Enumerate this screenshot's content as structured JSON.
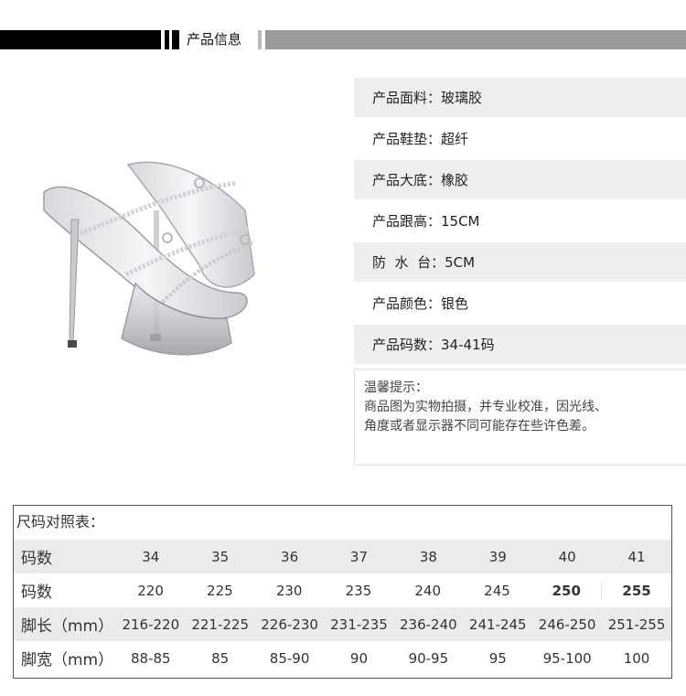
{
  "header": {
    "title": "产品信息"
  },
  "specs": [
    {
      "text": "产品面料：玻璃胶"
    },
    {
      "text": "产品鞋垫：超纤"
    },
    {
      "text": "产品大底：橡胶"
    },
    {
      "text": "产品跟高：15CM"
    },
    {
      "text": "防  水  台：5CM"
    },
    {
      "text": "产品颜色：银色"
    },
    {
      "text": "产品码数：34-41码"
    }
  ],
  "notice": {
    "title": "温馨提示：",
    "line1": "商品图为实物拍摄，并专业校准，因光线、",
    "line2": "角度或者显示器不同可能存在些许色差。"
  },
  "size_table": {
    "title": "尺码对照表：",
    "rows": [
      {
        "label": "码数",
        "cells": [
          "34",
          "35",
          "36",
          "37",
          "38",
          "39",
          "40",
          "41"
        ]
      },
      {
        "label": "码数",
        "cells": [
          "220",
          "225",
          "230",
          "235",
          "240",
          "245",
          "250",
          "255"
        ]
      },
      {
        "label": "脚长（mm）",
        "cells": [
          "216-220",
          "221-225",
          "226-230",
          "231-235",
          "236-240",
          "241-245",
          "246-250",
          "251-255"
        ]
      },
      {
        "label": "脚宽（mm）",
        "cells": [
          "88-85",
          "85",
          "85-90",
          "90",
          "90-95",
          "95",
          "95-100",
          "100"
        ]
      }
    ]
  }
}
